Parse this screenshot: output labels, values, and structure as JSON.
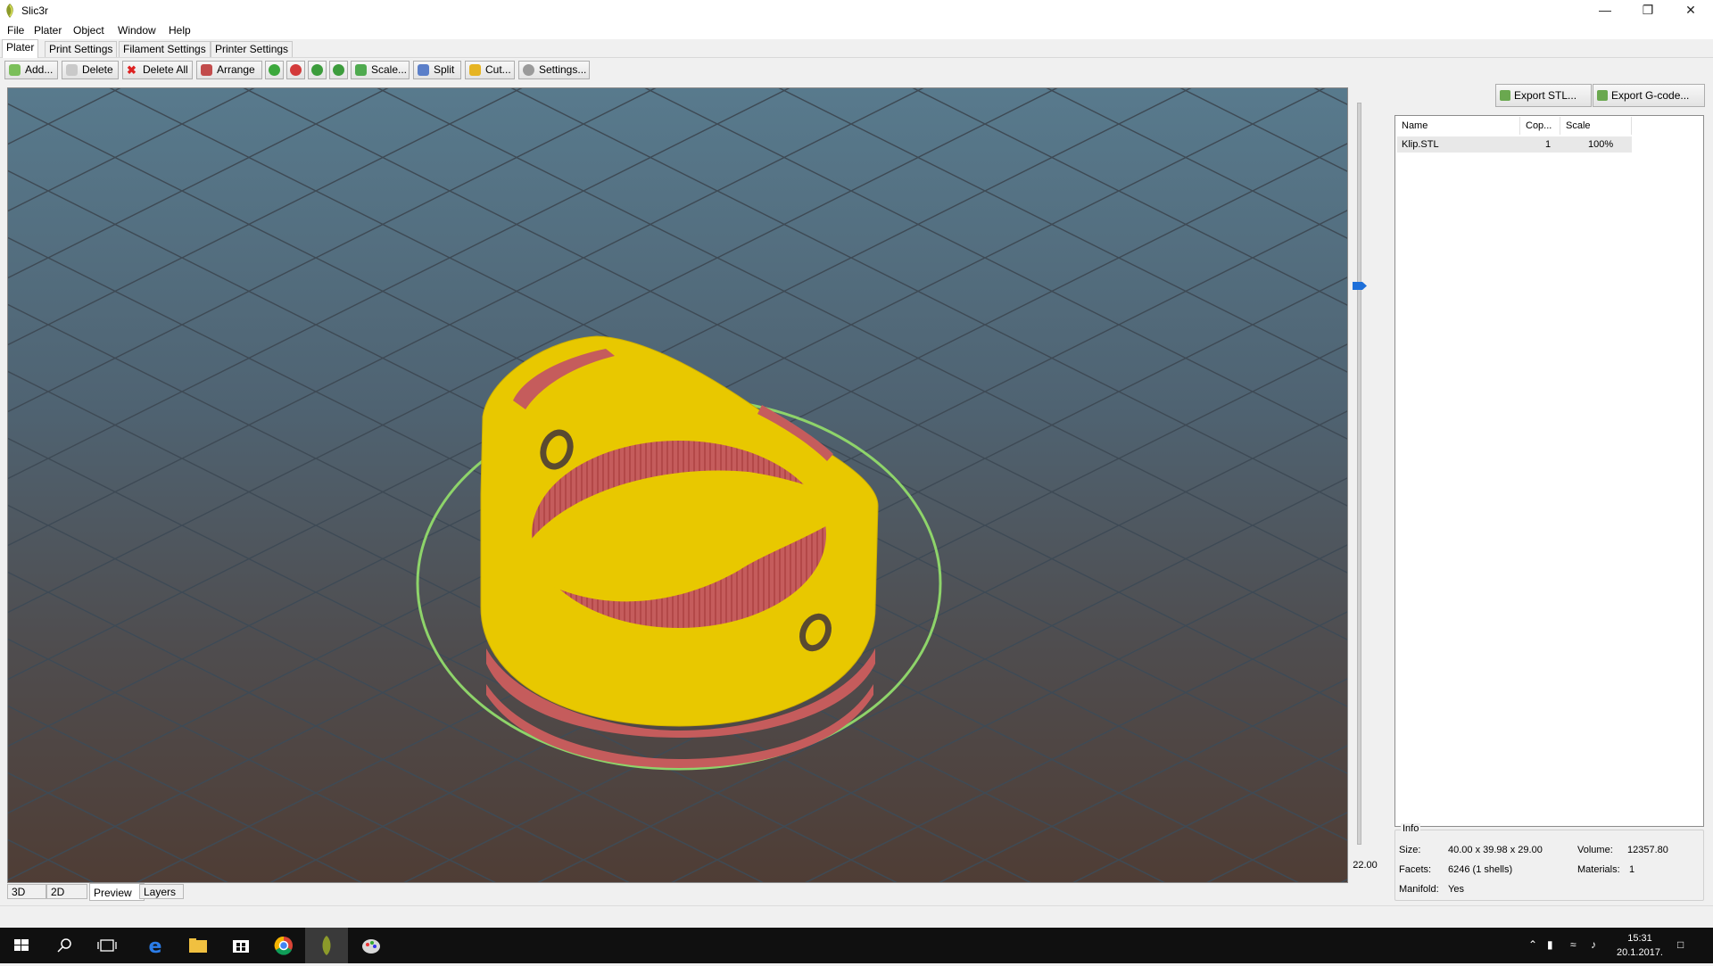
{
  "window": {
    "title": "Slic3r"
  },
  "menu": [
    "File",
    "Plater",
    "Object",
    "Window",
    "Help"
  ],
  "tabs": [
    "Plater",
    "Print Settings",
    "Filament Settings",
    "Printer Settings"
  ],
  "toolbar": {
    "add": "Add...",
    "delete": "Delete",
    "delete_all": "Delete All",
    "arrange": "Arrange",
    "scale": "Scale...",
    "split": "Split",
    "cut": "Cut...",
    "settings": "Settings..."
  },
  "export": {
    "stl": "Export STL...",
    "gcode": "Export G-code..."
  },
  "object_list": {
    "headers": [
      "Name",
      "Cop...",
      "Scale"
    ],
    "rows": [
      {
        "name": "Klip.STL",
        "copies": "1",
        "scale": "100%"
      }
    ]
  },
  "layer_slider": {
    "value": "22.00"
  },
  "view_tabs": [
    "3D",
    "2D",
    "Preview",
    "Layers"
  ],
  "info": {
    "legend": "Info",
    "size_label": "Size:",
    "size": "40.00 x 39.98 x 29.00",
    "volume_label": "Volume:",
    "volume": "12357.80",
    "facets_label": "Facets:",
    "facets": "6246 (1 shells)",
    "materials_label": "Materials:",
    "materials": "1",
    "manifold_label": "Manifold:",
    "manifold": "Yes"
  },
  "clock": {
    "time": "15:31",
    "date": "20.1.2017."
  },
  "colors": {
    "model": "#e8c800",
    "infill": "#c85a5a",
    "bed_ring": "#8ed46a",
    "accent": "#1e6fd9"
  }
}
